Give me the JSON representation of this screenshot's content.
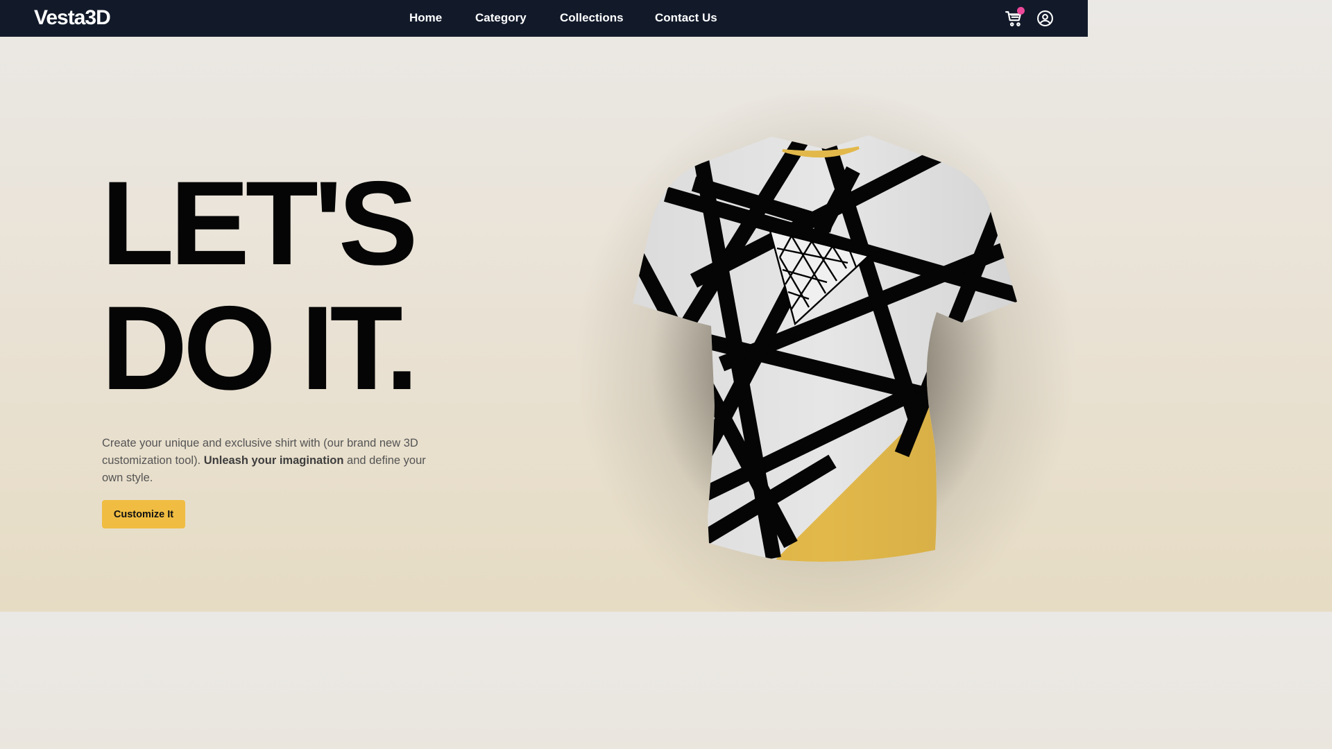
{
  "nav": {
    "logo": "Vesta3D",
    "links": [
      "Home",
      "Category",
      "Collections",
      "Contact Us"
    ]
  },
  "hero": {
    "headline_line1": "LET'S",
    "headline_line2": "DO IT.",
    "description_part1": "Create your unique and exclusive shirt with (our brand new 3D customization tool). ",
    "description_bold": "Unleash your imagination",
    "description_part2": " and define your own style.",
    "cta_label": "Customize It"
  },
  "icons": {
    "cart": "cart-icon",
    "user": "user-circle-icon",
    "shirt": "tshirt-3d-model"
  },
  "colors": {
    "navbar": "#121a2a",
    "accent": "#f0bd42",
    "cart_badge": "#ec4899",
    "shirt_yellow": "#e2b84a"
  }
}
